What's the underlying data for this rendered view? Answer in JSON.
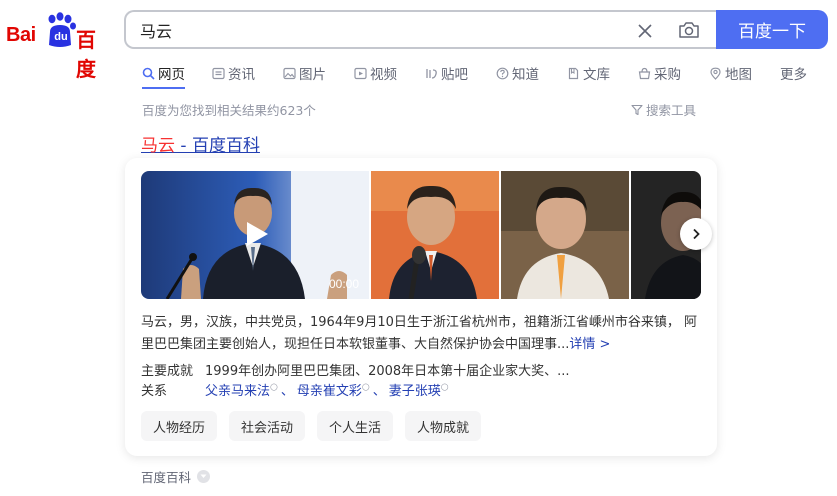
{
  "logo": {
    "bai": "Bai",
    "du": "du",
    "cn": "百度"
  },
  "search": {
    "query": "马云",
    "button_label": "百度一下"
  },
  "tabs": [
    {
      "label": "网页",
      "icon": "search-icon",
      "active": true
    },
    {
      "label": "资讯",
      "icon": "news-icon"
    },
    {
      "label": "图片",
      "icon": "image-icon"
    },
    {
      "label": "视频",
      "icon": "video-icon"
    },
    {
      "label": "贴吧",
      "icon": "tieba-icon"
    },
    {
      "label": "知道",
      "icon": "question-icon"
    },
    {
      "label": "文库",
      "icon": "document-icon"
    },
    {
      "label": "采购",
      "icon": "basket-icon"
    },
    {
      "label": "地图",
      "icon": "map-pin-icon"
    },
    {
      "label": "更多"
    }
  ],
  "results_info": {
    "count_text": "百度为您找到相关结果约623个",
    "tools_label": "搜索工具"
  },
  "result": {
    "title_highlight": "马云",
    "title_rest": " - 百度百科",
    "video_duration": "00:00",
    "summary": "马云，男，汉族，中共党员，1964年9月10日生于浙江省杭州市，祖籍浙江省嵊州市谷来镇， 阿里巴巴集团主要创始人，现担任日本软银董事、大自然保护协会中国理事...",
    "more_label": "详情 >",
    "achievements_label": "主要成就",
    "achievements_value": "1999年创办阿里巴巴集团、2008年日本第十届企业家大奖、...",
    "relations_label": "关系",
    "relations": [
      "父亲马来法",
      "母亲崔文彩",
      "妻子张瑛"
    ],
    "chips": [
      "人物经历",
      "社会活动",
      "个人生活",
      "人物成就"
    ],
    "source": "百度百科"
  },
  "colors": {
    "brand_red": "#e10602",
    "brand_blue": "#4e6ef2",
    "link": "#2440b3",
    "highlight": "#f73131"
  }
}
